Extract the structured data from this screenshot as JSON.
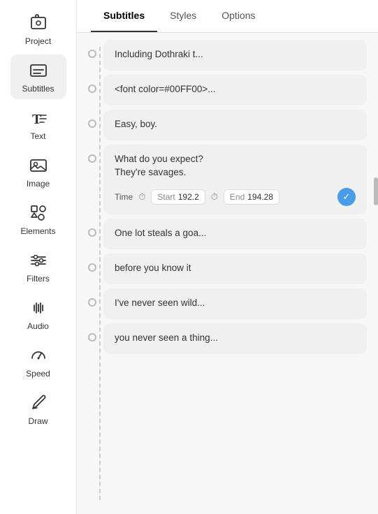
{
  "sidebar": {
    "items": [
      {
        "id": "project",
        "label": "Project",
        "icon": "project"
      },
      {
        "id": "subtitles",
        "label": "Subtitles",
        "icon": "subtitles",
        "active": true
      },
      {
        "id": "text",
        "label": "Text",
        "icon": "text"
      },
      {
        "id": "image",
        "label": "Image",
        "icon": "image"
      },
      {
        "id": "elements",
        "label": "Elements",
        "icon": "elements"
      },
      {
        "id": "filters",
        "label": "Filters",
        "icon": "filters"
      },
      {
        "id": "audio",
        "label": "Audio",
        "icon": "audio"
      },
      {
        "id": "speed",
        "label": "Speed",
        "icon": "speed"
      },
      {
        "id": "draw",
        "label": "Draw",
        "icon": "draw"
      }
    ]
  },
  "tabs": [
    {
      "label": "Subtitles",
      "active": true
    },
    {
      "label": "Styles",
      "active": false
    },
    {
      "label": "Options",
      "active": false
    }
  ],
  "subtitles": [
    {
      "id": 1,
      "text": "Including Dothraki t...",
      "active": false,
      "showTime": false
    },
    {
      "id": 2,
      "text": "<font color=#00FF00>...",
      "active": false,
      "showTime": false
    },
    {
      "id": 3,
      "text": "Easy, boy.",
      "active": false,
      "showTime": false
    },
    {
      "id": 4,
      "text": "What do you expect?\nThey're savages.",
      "active": true,
      "showTime": true,
      "timeLabel": "Time",
      "startLabel": "Start",
      "startValue": "192.2",
      "endLabel": "End",
      "endValue": "194.28"
    },
    {
      "id": 5,
      "text": "One lot steals a goa...",
      "active": false,
      "showTime": false
    },
    {
      "id": 6,
      "text": "before you know it",
      "active": false,
      "showTime": false
    },
    {
      "id": 7,
      "text": "I've never seen wild...",
      "active": false,
      "showTime": false
    },
    {
      "id": 8,
      "text": "you never seen a thing...",
      "active": false,
      "showTime": false
    }
  ]
}
